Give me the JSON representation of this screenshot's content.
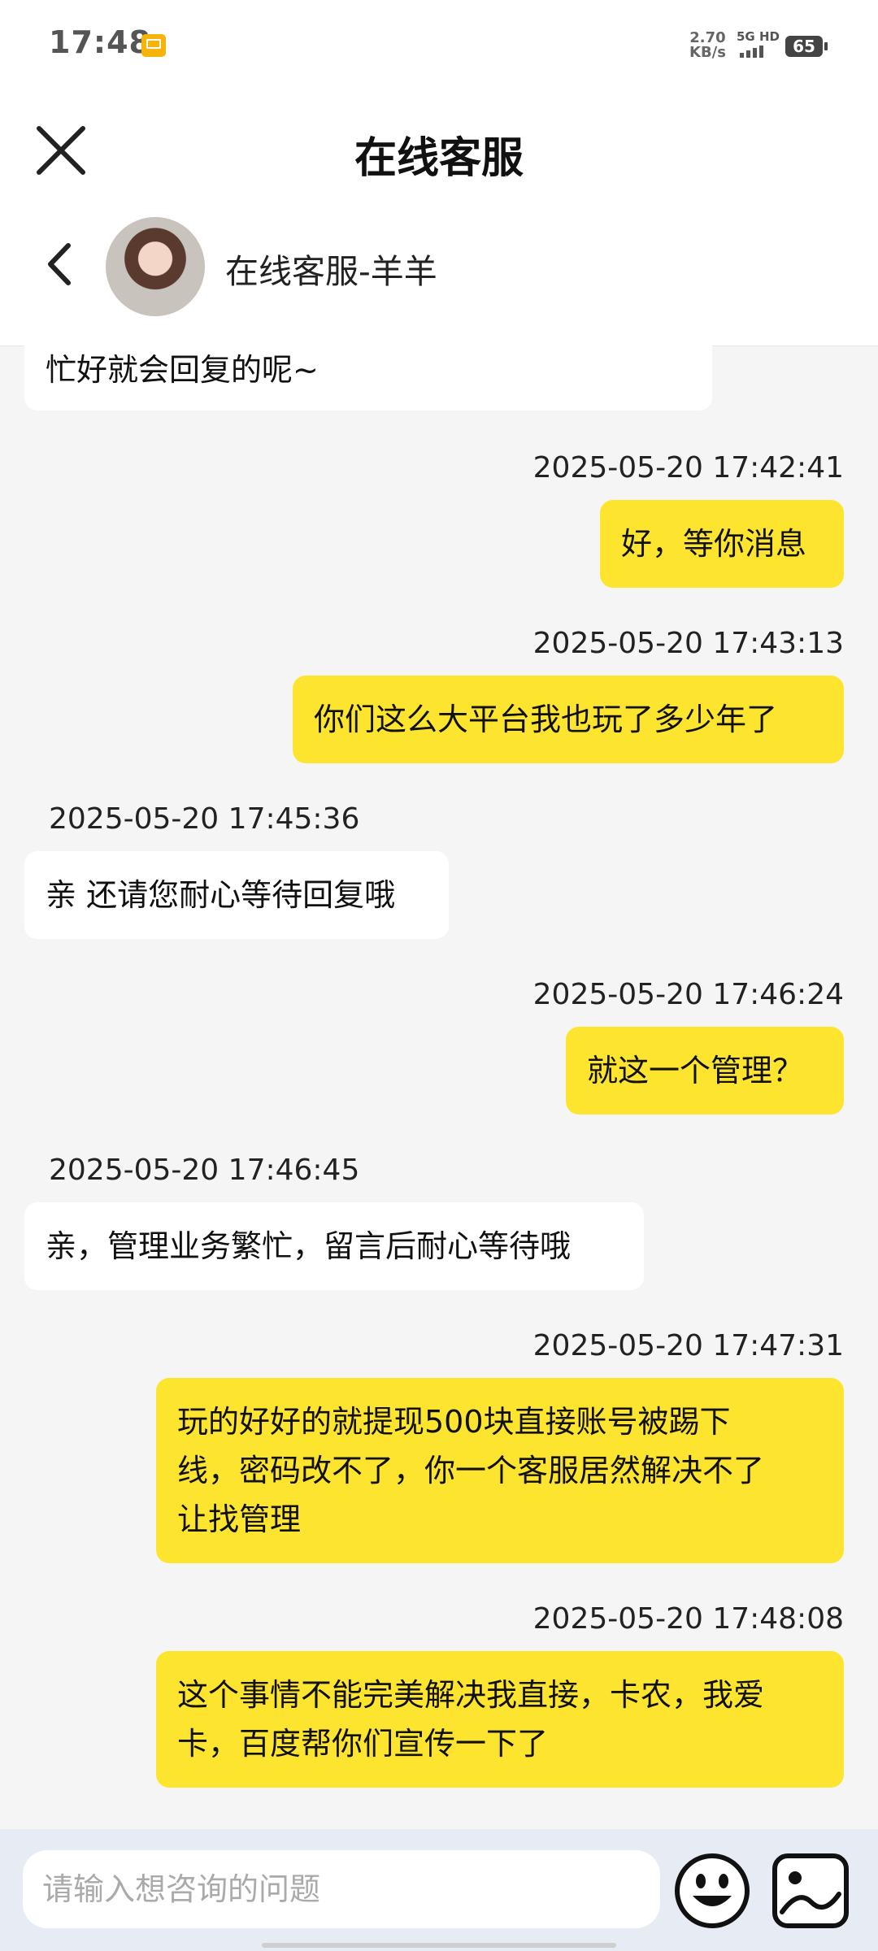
{
  "status_bar": {
    "time": "17:48",
    "net_speed_value": "2.70",
    "net_speed_unit": "KB/s",
    "network": "5G HD",
    "battery": "65"
  },
  "header": {
    "title": "在线客服",
    "agent_name": "在线客服-羊羊"
  },
  "messages": [
    {
      "side": "them",
      "time": "",
      "lines": [
        "忙好就会回复的呢~"
      ]
    },
    {
      "side": "me",
      "time": "2025-05-20 17:42:41",
      "lines": [
        "好，等你消息"
      ]
    },
    {
      "side": "me",
      "time": "2025-05-20 17:43:13",
      "lines": [
        "你们这么大平台我也玩了多少年了"
      ]
    },
    {
      "side": "them",
      "time": "2025-05-20 17:45:36",
      "lines": [
        "亲 还请您耐心等待回复哦"
      ]
    },
    {
      "side": "me",
      "time": "2025-05-20 17:46:24",
      "lines": [
        "就这一个管理？"
      ]
    },
    {
      "side": "them",
      "time": "2025-05-20 17:46:45",
      "lines": [
        "亲，管理业务繁忙，留言后耐心等待哦"
      ]
    },
    {
      "side": "me",
      "time": "2025-05-20 17:47:31",
      "lines": [
        "玩的好好的就提现500块直接账号被踢下",
        "线，密码改不了，你一个客服居然解决不了",
        "让找管理"
      ]
    },
    {
      "side": "me",
      "time": "2025-05-20 17:48:08",
      "lines": [
        "这个事情不能完美解决我直接，卡农，我爱",
        "卡，百度帮你们宣传一下了"
      ]
    }
  ],
  "input": {
    "placeholder": "请输入想咨询的问题"
  },
  "colors": {
    "my_bubble": "#fde52f",
    "their_bubble": "#ffffff",
    "chat_background": "#f5f5f5",
    "input_bar": "#e7ebf3"
  },
  "icons": [
    "close-icon",
    "back-arrow-icon",
    "emoji-icon",
    "image-icon",
    "mail-notification-icon",
    "signal-icon",
    "battery-icon"
  ]
}
